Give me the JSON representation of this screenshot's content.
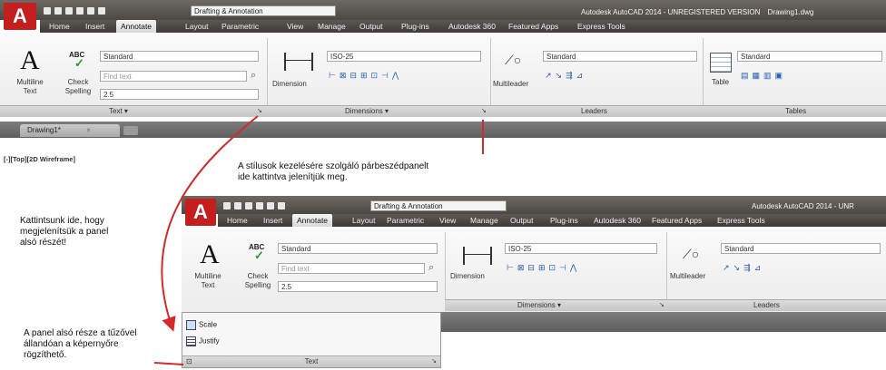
{
  "top": {
    "workspace": "Drafting & Annotation",
    "app_title": "Autodesk AutoCAD 2014 - UNREGISTERED VERSION",
    "doc_name": "Drawing1.dwg",
    "tabs": [
      "Home",
      "Insert",
      "Annotate",
      "Layout",
      "Parametric",
      "View",
      "Manage",
      "Output",
      "Plug-ins",
      "Autodesk 360",
      "Featured Apps",
      "Express Tools"
    ],
    "active_tab": "Annotate",
    "text_panel": {
      "big_label_1": "Multiline",
      "big_label_2": "Text",
      "check_label_1": "Check",
      "check_label_2": "Spelling",
      "abc": "ABC",
      "style": "Standard",
      "find": "Find text",
      "height": "2.5",
      "panel_name": "Text ▾"
    },
    "dim_panel": {
      "label": "Dimension",
      "style": "ISO-25",
      "panel_name": "Dimensions ▾"
    },
    "leader_panel": {
      "label": "Multileader",
      "style": "Standard",
      "panel_name": "Leaders"
    },
    "table_panel": {
      "label": "Table",
      "style": "Standard",
      "panel_name": "Tables"
    },
    "doc_tab": "Drawing1*",
    "viewport_label": "[-][Top][2D Wireframe]"
  },
  "bottom": {
    "workspace": "Drafting & Annotation",
    "app_title": "Autodesk AutoCAD 2014 - UNR",
    "tabs": [
      "Home",
      "Insert",
      "Annotate",
      "Layout",
      "Parametric",
      "View",
      "Manage",
      "Output",
      "Plug-ins",
      "Autodesk 360",
      "Featured Apps",
      "Express Tools"
    ],
    "text_panel": {
      "big_label_1": "Multiline",
      "big_label_2": "Text",
      "check_label_1": "Check",
      "check_label_2": "Spelling",
      "abc": "ABC",
      "style": "Standard",
      "find": "Find text",
      "height": "2.5",
      "scale": "Scale",
      "justify": "Justify",
      "panel_name": "Text"
    },
    "dim_panel": {
      "label": "Dimension",
      "style": "ISO-25",
      "panel_name": "Dimensions ▾"
    },
    "leader_panel": {
      "label": "Multileader",
      "style": "Standard",
      "panel_name": "Leaders"
    }
  },
  "annotations": {
    "dialog_note_1": "A stílusok kezelésére szolgáló párbeszédpanelt",
    "dialog_note_2": "ide kattintva jelenítjük meg.",
    "click_note_1": "Kattintsunk ide, hogy",
    "click_note_2": "megjelenítsük a panel",
    "click_note_3": "alsó részét!",
    "pin_note_1": "A panel alsó része a tűzővel",
    "pin_note_2": "állandóan a képernyőre",
    "pin_note_3": "rögzíthető."
  },
  "colors": {
    "annotation_arrow": "#d42a2a",
    "autocad_red": "#c41e1e"
  }
}
